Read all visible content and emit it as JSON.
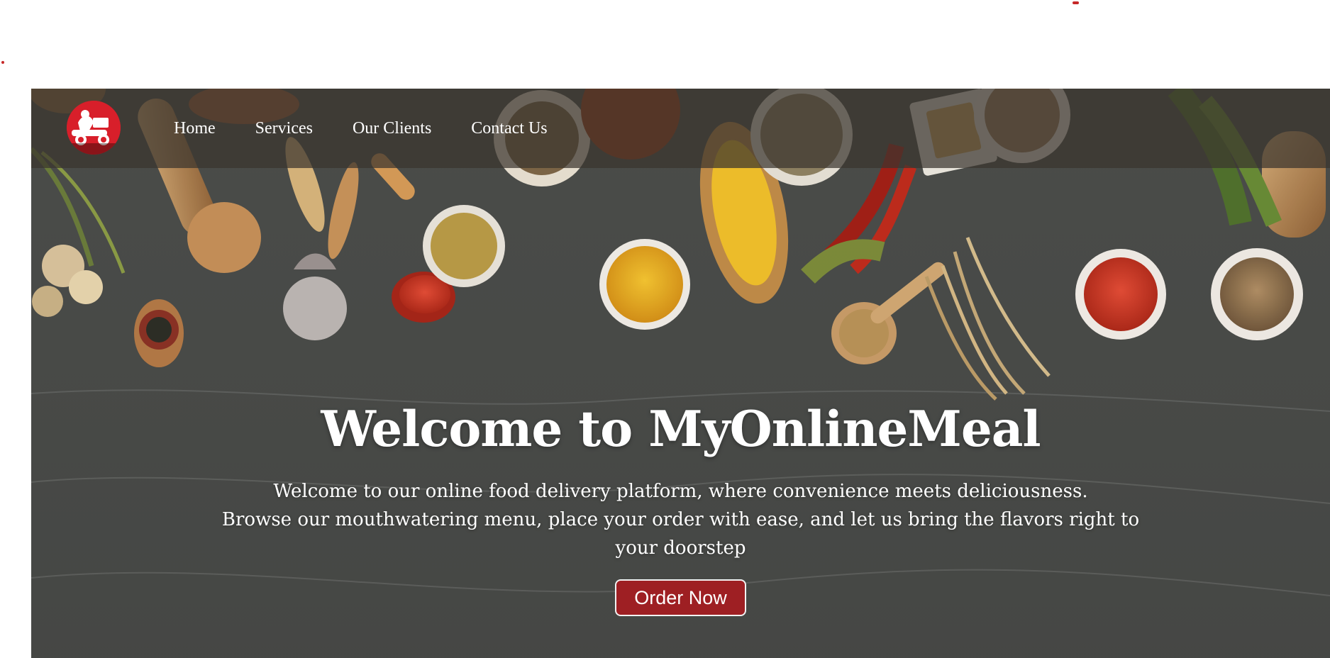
{
  "nav": {
    "logo_alt": "MyOnlineMeal logo",
    "links": [
      {
        "label": "Home"
      },
      {
        "label": "Services"
      },
      {
        "label": "Our Clients"
      },
      {
        "label": "Contact Us"
      }
    ]
  },
  "hero": {
    "title": "Welcome to MyOnlineMeal",
    "line1": "Welcome to our online food delivery platform, where convenience meets deliciousness.",
    "line2": "Browse our mouthwatering menu, place your order with ease, and let us bring the flavors right to your doorstep",
    "button_label": "Order Now"
  },
  "colors": {
    "brand_red": "#9e1f23",
    "logo_red": "#d81f2a",
    "nav_overlay": "rgba(58,52,46,0.72)",
    "hero_dark": "#4b4d4a",
    "text": "#ffffff"
  },
  "icons": {
    "logo": "delivery-scooter-icon"
  }
}
